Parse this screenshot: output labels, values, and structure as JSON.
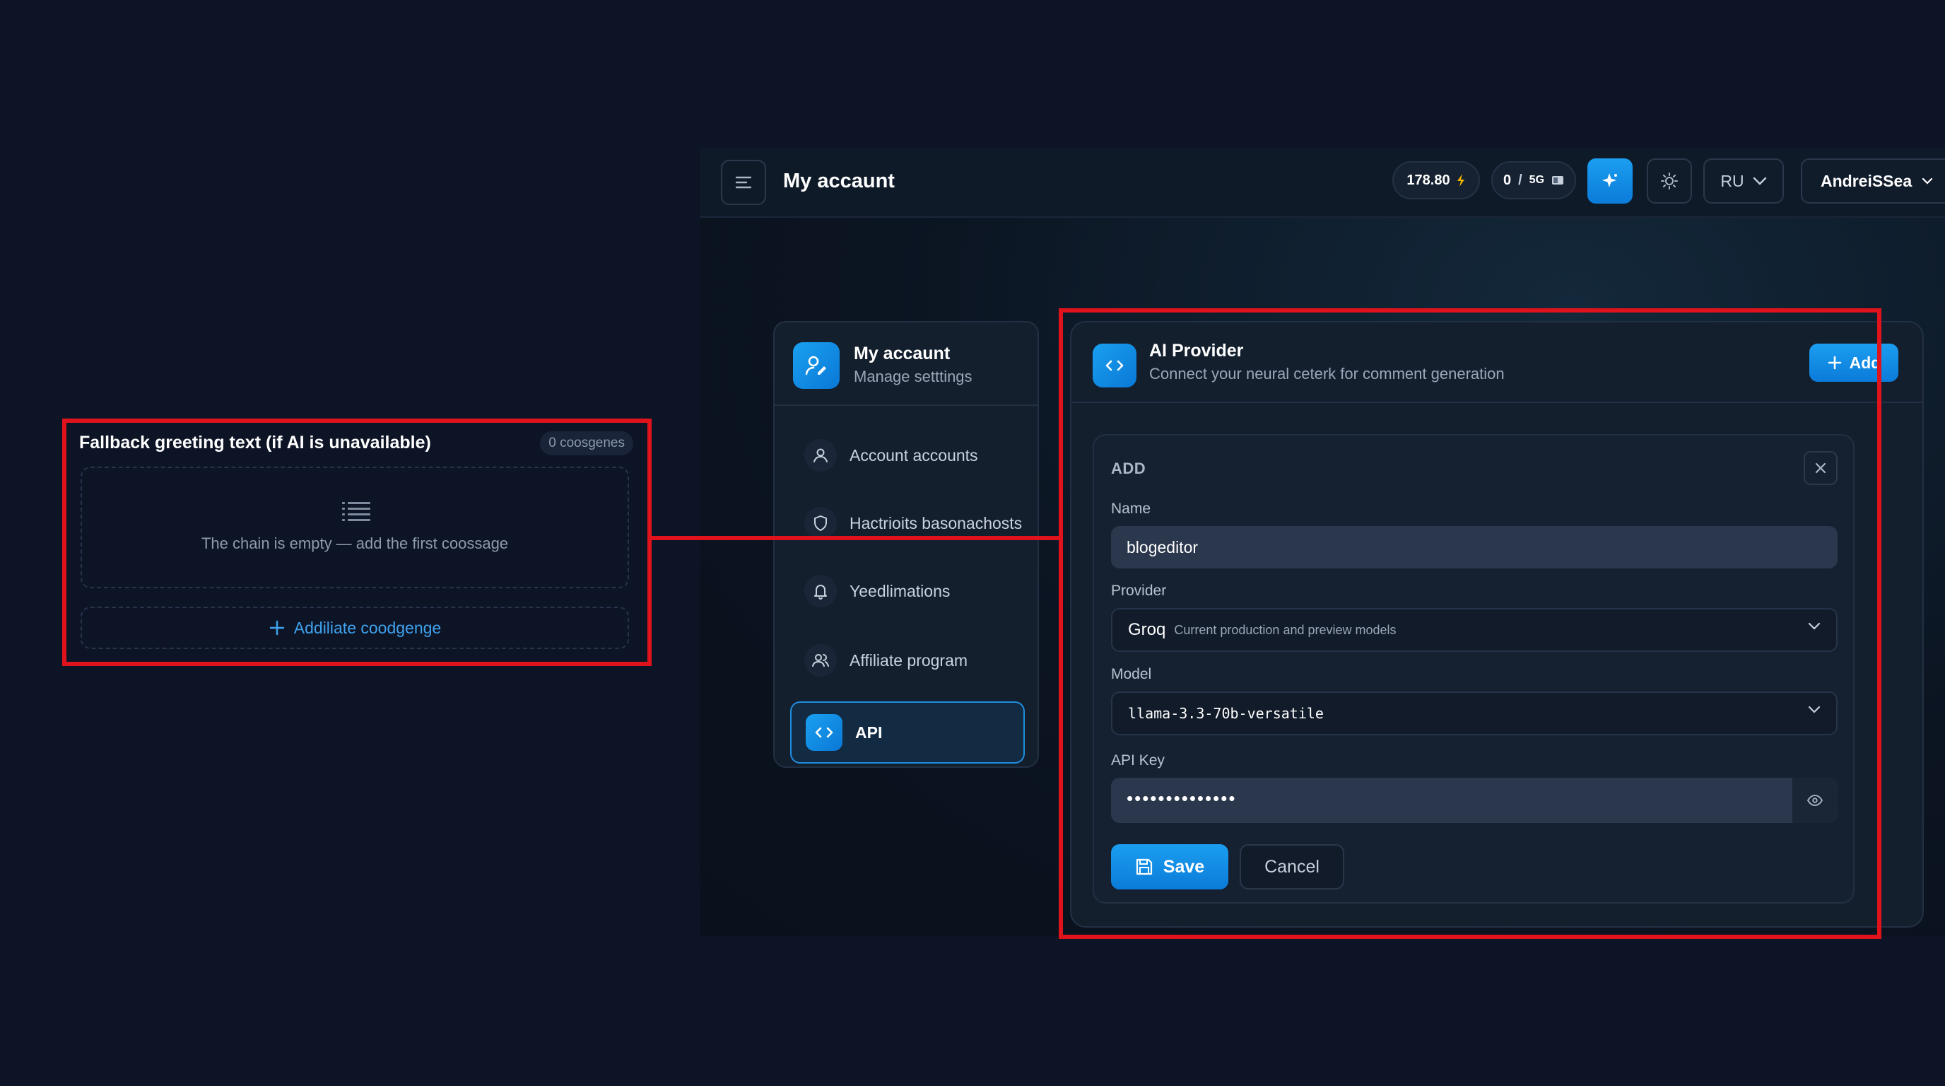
{
  "callout": {
    "title": "Fallback greeting text (if AI is unavailable)",
    "badge": "0 coosgenes",
    "empty_text": "The chain is empty — add the first coossage",
    "add_label": "Addiliate coodgenge"
  },
  "topbar": {
    "title": "My accaunt",
    "balance": "178.80",
    "usage_current": "0",
    "usage_separator": "/",
    "usage_total": "5G",
    "language": "RU",
    "username": "AndreiSSea"
  },
  "sidebar": {
    "header_title": "My accaunt",
    "header_subtitle": "Manage setttings",
    "items": [
      {
        "label": "Account accounts",
        "icon": "user-icon"
      },
      {
        "label": "Hactrioits basonachosts",
        "icon": "shield-icon"
      },
      {
        "label": "Yeedlimations",
        "icon": "bell-icon"
      },
      {
        "label": "Affiliate program",
        "icon": "users-icon"
      },
      {
        "label": "API",
        "icon": "code-icon",
        "active": true
      }
    ]
  },
  "provider_panel": {
    "title": "AI Provider",
    "subtitle": "Connect your neural ceterk for comment generation",
    "add_label": "Add",
    "form": {
      "heading": "ADD",
      "name_label": "Name",
      "name_value": "blogeditor",
      "provider_label": "Provider",
      "provider_value": "Groq",
      "provider_hint": "Current production and preview models",
      "model_label": "Model",
      "model_value": "llama-3.3-70b-versatile",
      "api_key_label": "API Key",
      "api_key_value": "••••••••••••••",
      "save_label": "Save",
      "cancel_label": "Cancel"
    }
  },
  "colors": {
    "background": "#0d1426",
    "accent": "#1b9ef0",
    "annotation": "#e0131c"
  }
}
